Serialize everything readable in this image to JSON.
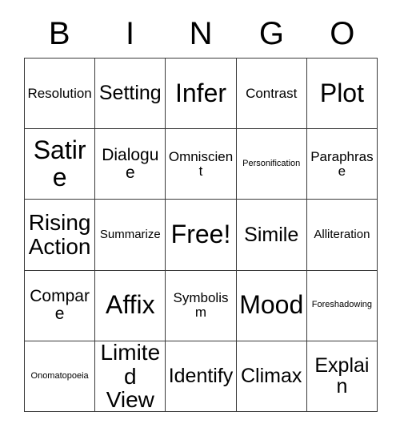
{
  "card": {
    "title": "Bingo Card",
    "header_letters": [
      "B",
      "I",
      "N",
      "G",
      "O"
    ],
    "grid_size": "5x5",
    "colors": {
      "background": "#ffffff",
      "text": "#000000",
      "grid_line": "#3a3a3a"
    },
    "rows": [
      [
        {
          "text": "Resolution",
          "size": "fs-s",
          "free": false
        },
        {
          "text": "Setting",
          "size": "fs-l",
          "free": false
        },
        {
          "text": "Infer",
          "size": "fs-xxl",
          "free": false
        },
        {
          "text": "Contrast",
          "size": "fs-s",
          "free": false
        },
        {
          "text": "Plot",
          "size": "fs-xxl",
          "free": false
        }
      ],
      [
        {
          "text": "Satire",
          "size": "fs-xxl",
          "free": false
        },
        {
          "text": "Dialogue",
          "size": "fs-m",
          "free": false
        },
        {
          "text": "Omniscient",
          "size": "fs-s",
          "free": false
        },
        {
          "text": "Personification",
          "size": "fs-xxs",
          "free": false
        },
        {
          "text": "Paraphrase",
          "size": "fs-s",
          "free": false
        }
      ],
      [
        {
          "text": "Rising Action",
          "size": "fs-xl",
          "free": false
        },
        {
          "text": "Summarize",
          "size": "fs-xs",
          "free": false
        },
        {
          "text": "Free!",
          "size": "fs-xxl",
          "free": true
        },
        {
          "text": "Simile",
          "size": "fs-l",
          "free": false
        },
        {
          "text": "Alliteration",
          "size": "fs-xs",
          "free": false
        }
      ],
      [
        {
          "text": "Compare",
          "size": "fs-m",
          "free": false
        },
        {
          "text": "Affix",
          "size": "fs-xxl",
          "free": false
        },
        {
          "text": "Symbolism",
          "size": "fs-s",
          "free": false
        },
        {
          "text": "Mood",
          "size": "fs-xxl",
          "free": false
        },
        {
          "text": "Foreshadowing",
          "size": "fs-xxs",
          "free": false
        }
      ],
      [
        {
          "text": "Onomatopoeia",
          "size": "fs-xxs",
          "free": false
        },
        {
          "text": "Limited View",
          "size": "fs-xl",
          "free": false
        },
        {
          "text": "Identify",
          "size": "fs-l",
          "free": false
        },
        {
          "text": "Climax",
          "size": "fs-l",
          "free": false
        },
        {
          "text": "Explain",
          "size": "fs-l",
          "free": false
        }
      ]
    ]
  }
}
